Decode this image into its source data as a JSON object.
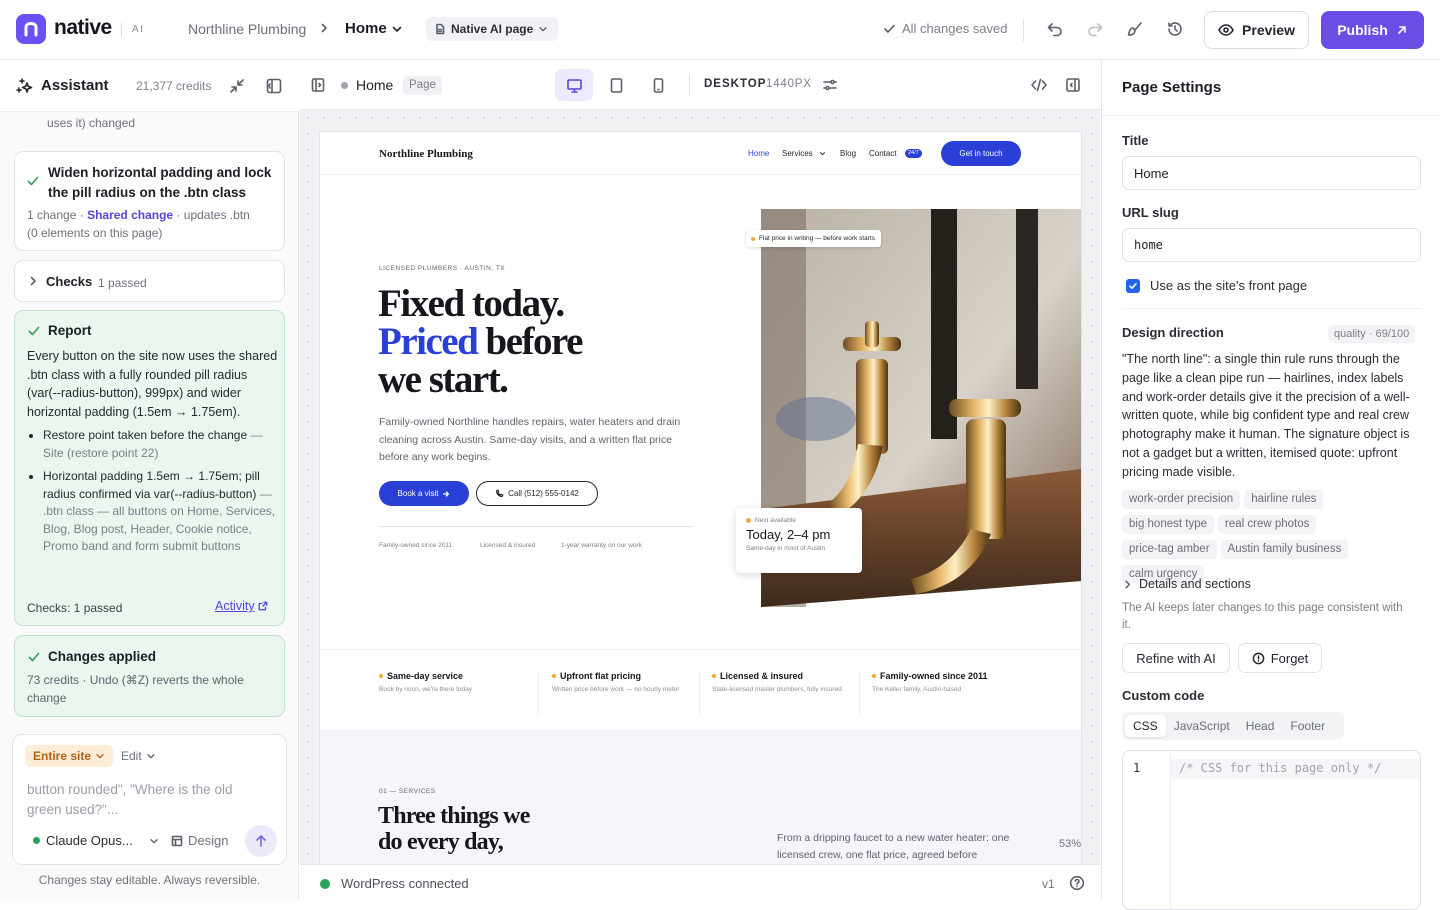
{
  "app": {
    "logo_text": "native",
    "logo_ai": "AI",
    "site_name": "Northline Plumbing",
    "page_name": "Home",
    "page_type": "Native AI page",
    "save_status": "All changes saved",
    "preview_label": "Preview",
    "publish_label": "Publish",
    "accent_color": "#6b4de6"
  },
  "assistant": {
    "title": "Assistant",
    "credits": "21,377 credits",
    "truncated_text": "uses it) changed",
    "change_card": {
      "title": "Widen horizontal padding and lock the pill radius on the .btn class",
      "meta_count": "1 change ·",
      "meta_shared": "Shared change",
      "meta_rest": "· updates .btn",
      "meta_line2": "(0 elements on this page)"
    },
    "checks": {
      "label": "Checks",
      "value": "1 passed"
    },
    "report": {
      "title": "Report",
      "body": "Every button on the site now uses the shared .btn class with a fully rounded pill radius (var(--radius-button), 999px) and wider horizontal padding (1.5em → 1.75em).",
      "bullet1_main": "Restore point taken before the change",
      "bullet1_muted": "— Site (restore point 22)",
      "bullet2_main": "Horizontal padding 1.5em → 1.75em; pill radius confirmed via var(--radius-button)",
      "bullet2_muted": "— .btn class — all buttons on Home, Services, Blog, Blog post, Header, Cookie notice, Promo band and form submit buttons",
      "checks_text": "Checks: 1 passed",
      "activity_link": "Activity"
    },
    "applied": {
      "title": "Changes applied",
      "text": "73 credits · Undo (⌘Z) reverts the whole change"
    },
    "composer": {
      "scope": "Entire site",
      "mode": "Edit",
      "placeholder_top": "button rounded\", \"Where is the old green used?\"...",
      "model": "Claude Opus...",
      "design_label": "Design"
    },
    "footer": "Changes stay editable. Always reversible."
  },
  "canvas_bar": {
    "page": "Home",
    "badge": "Page",
    "device_label": "DESKTOP",
    "device_width": "1440PX"
  },
  "site": {
    "brand": "Northline Plumbing",
    "nav": [
      "Home",
      "Services",
      "Blog",
      "Contact"
    ],
    "nav_badge": "24/7",
    "cta": "Get in touch",
    "eyebrow": "LICENSED PLUMBERS · AUSTIN, TX",
    "headline_1": "Fixed today.",
    "headline_2a": "Priced",
    "headline_2b": " before",
    "headline_3": "we start.",
    "intro": "Family-owned Northline handles repairs, water heaters and drain cleaning across Austin. Same-day visits, and a written flat price before any work begins.",
    "btn_primary": "Book a visit",
    "btn_secondary": "Call (512) 555-0142",
    "trust": [
      "Family-owned since 2011",
      "Licensed & insured",
      "1-year warranty on our work"
    ],
    "photo_chip": "Flat price in writing — before work starts",
    "avail_label": "Next available",
    "avail_time": "Today, 2–4 pm",
    "avail_sub": "Same-day in most of Austin",
    "features": [
      {
        "title": "Same-day service",
        "text": "Book by noon, we're there today"
      },
      {
        "title": "Upfront flat pricing",
        "text": "Written price before work — no hourly meter"
      },
      {
        "title": "Licensed & insured",
        "text": "State-licensed master plumbers, fully insured"
      },
      {
        "title": "Family-owned since 2011",
        "text": "The Keller family, Austin-based"
      }
    ],
    "services_eyebrow": "01 — SERVICES",
    "services_h_1": "Three things we",
    "services_h_2": "do every day,",
    "services_intro": "From a dripping faucet to a new water heater: one licensed crew, one flat price, agreed before",
    "accent": "#2a3fd6",
    "amber": "#f2a93b"
  },
  "canvas_footer": {
    "status": "WordPress connected",
    "zoom": "53%",
    "version": "v1"
  },
  "settings": {
    "title": "Page Settings",
    "title_label": "Title",
    "title_value": "Home",
    "slug_label": "URL slug",
    "slug_value": "home",
    "front_page_label": "Use as the site's front page",
    "front_page_checked": true,
    "design_label": "Design direction",
    "quality": "quality · 69/100",
    "design_text": "\"The north line\": a single thin rule runs through the page like a clean pipe run — hairlines, index labels and work-order details give it the precision of a well-written quote, while big confident type and real crew photography make it human. The signature object is not a gadget but a written, itemised quote: upfront pricing made visible.",
    "tags": [
      "work-order precision",
      "hairline rules",
      "big honest type",
      "real crew photos",
      "price-tag amber",
      "Austin family business",
      "calm urgency"
    ],
    "details_label": "Details and sections",
    "consistency_note": "The AI keeps later changes to this page consistent with it.",
    "refine_label": "Refine with AI",
    "forget_label": "Forget",
    "custom_code_label": "Custom code",
    "code_tabs": [
      "CSS",
      "JavaScript",
      "Head",
      "Footer"
    ],
    "code_line_no": "1",
    "code_line": "/* CSS for this page only */"
  }
}
